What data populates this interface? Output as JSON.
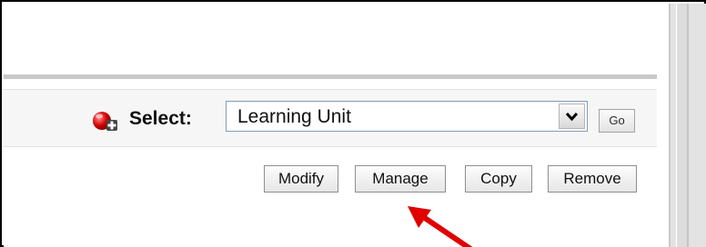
{
  "toolbar": {
    "select_label": "Select:",
    "select_icon": "add-select-icon",
    "dropdown_value": "Learning Unit",
    "go_label": "Go"
  },
  "actions": {
    "modify": "Modify",
    "manage": "Manage",
    "copy": "Copy",
    "remove": "Remove"
  },
  "annotation": {
    "arrow_color": "#e00000"
  }
}
